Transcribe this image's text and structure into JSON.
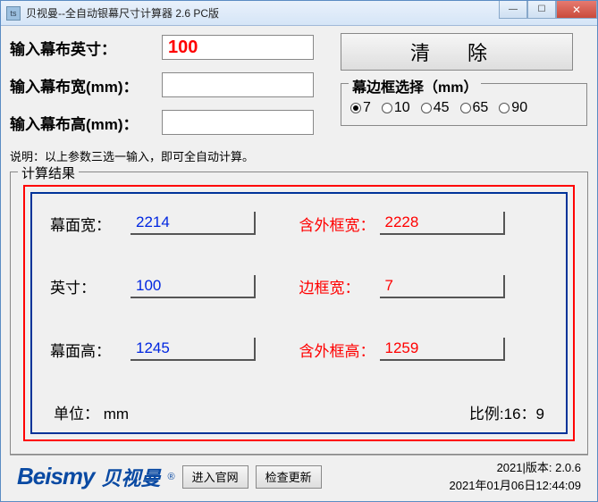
{
  "titlebar": {
    "icon_text": "ts",
    "title": "贝视曼--全自动银幕尺寸计算器 2.6 PC版"
  },
  "inputs": {
    "inch_label": "输入幕布英寸：",
    "inch_value": "100",
    "width_label": "输入幕布宽(mm)：",
    "width_value": "",
    "height_label": "输入幕布高(mm)：",
    "height_value": ""
  },
  "clear_label": "清   除",
  "frame": {
    "legend": "幕边框选择（mm）",
    "options": [
      "7",
      "10",
      "45",
      "65",
      "90"
    ],
    "selected": "7"
  },
  "note": "说明：以上参数三选一输入，即可全自动计算。",
  "results": {
    "legend": "计算结果",
    "screen_width_label": "幕面宽：",
    "screen_width_value": "2214",
    "outer_width_label": "含外框宽：",
    "outer_width_value": "2228",
    "inch_label": "英寸：",
    "inch_value": "100",
    "border_width_label": "边框宽：",
    "border_width_value": "7",
    "screen_height_label": "幕面高：",
    "screen_height_value": "1245",
    "outer_height_label": "含外框高：",
    "outer_height_value": "1259",
    "unit_text": "单位： mm",
    "ratio_text": "比例:16：9"
  },
  "footer": {
    "logo_en": "Beismy",
    "logo_cn": "贝视曼",
    "reg": "®",
    "site_btn": "进入官网",
    "update_btn": "检查更新",
    "version_text": "2021|版本: 2.0.6",
    "datetime_text": "2021年01月06日12:44:09"
  }
}
